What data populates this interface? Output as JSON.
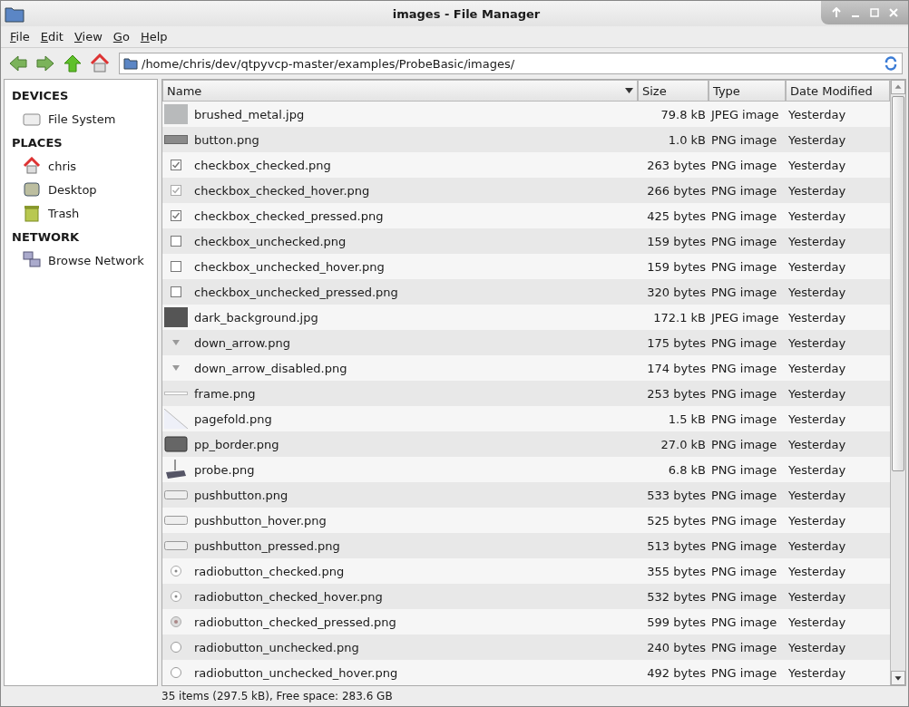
{
  "window": {
    "title": "images - File Manager"
  },
  "menu": [
    "File",
    "Edit",
    "View",
    "Go",
    "Help"
  ],
  "location": "/home/chris/dev/qtpyvcp-master/examples/ProbeBasic/images/",
  "sidebar": [
    {
      "heading": "DEVICES",
      "items": [
        {
          "label": "File System",
          "kind": "drive"
        }
      ]
    },
    {
      "heading": "PLACES",
      "items": [
        {
          "label": "chris",
          "kind": "home"
        },
        {
          "label": "Desktop",
          "kind": "desktop"
        },
        {
          "label": "Trash",
          "kind": "trash"
        }
      ]
    },
    {
      "heading": "NETWORK",
      "items": [
        {
          "label": "Browse Network",
          "kind": "network"
        }
      ]
    }
  ],
  "table": {
    "columns": [
      "Name",
      "Size",
      "Type",
      "Date Modified"
    ],
    "rows": [
      {
        "name": "brushed_metal.jpg",
        "size": "79.8 kB",
        "type": "JPEG image",
        "date": "Yesterday",
        "kind": "texture"
      },
      {
        "name": "button.png",
        "size": "1.0 kB",
        "type": "PNG image",
        "date": "Yesterday",
        "kind": "bar"
      },
      {
        "name": "checkbox_checked.png",
        "size": "263 bytes",
        "type": "PNG image",
        "date": "Yesterday",
        "kind": "checkbox"
      },
      {
        "name": "checkbox_checked_hover.png",
        "size": "266 bytes",
        "type": "PNG image",
        "date": "Yesterday",
        "kind": "checkbox-light"
      },
      {
        "name": "checkbox_checked_pressed.png",
        "size": "425 bytes",
        "type": "PNG image",
        "date": "Yesterday",
        "kind": "checkbox"
      },
      {
        "name": "checkbox_unchecked.png",
        "size": "159 bytes",
        "type": "PNG image",
        "date": "Yesterday",
        "kind": "box"
      },
      {
        "name": "checkbox_unchecked_hover.png",
        "size": "159 bytes",
        "type": "PNG image",
        "date": "Yesterday",
        "kind": "box"
      },
      {
        "name": "checkbox_unchecked_pressed.png",
        "size": "320 bytes",
        "type": "PNG image",
        "date": "Yesterday",
        "kind": "box"
      },
      {
        "name": "dark_background.jpg",
        "size": "172.1 kB",
        "type": "JPEG image",
        "date": "Yesterday",
        "kind": "dark"
      },
      {
        "name": "down_arrow.png",
        "size": "175 bytes",
        "type": "PNG image",
        "date": "Yesterday",
        "kind": "arrow"
      },
      {
        "name": "down_arrow_disabled.png",
        "size": "174 bytes",
        "type": "PNG image",
        "date": "Yesterday",
        "kind": "arrow"
      },
      {
        "name": "frame.png",
        "size": "253 bytes",
        "type": "PNG image",
        "date": "Yesterday",
        "kind": "line"
      },
      {
        "name": "pagefold.png",
        "size": "1.5 kB",
        "type": "PNG image",
        "date": "Yesterday",
        "kind": "fold"
      },
      {
        "name": "pp_border.png",
        "size": "27.0 kB",
        "type": "PNG image",
        "date": "Yesterday",
        "kind": "border"
      },
      {
        "name": "probe.png",
        "size": "6.8 kB",
        "type": "PNG image",
        "date": "Yesterday",
        "kind": "probe"
      },
      {
        "name": "pushbutton.png",
        "size": "533 bytes",
        "type": "PNG image",
        "date": "Yesterday",
        "kind": "pill"
      },
      {
        "name": "pushbutton_hover.png",
        "size": "525 bytes",
        "type": "PNG image",
        "date": "Yesterday",
        "kind": "pill"
      },
      {
        "name": "pushbutton_pressed.png",
        "size": "513 bytes",
        "type": "PNG image",
        "date": "Yesterday",
        "kind": "pill"
      },
      {
        "name": "radiobutton_checked.png",
        "size": "355 bytes",
        "type": "PNG image",
        "date": "Yesterday",
        "kind": "radio"
      },
      {
        "name": "radiobutton_checked_hover.png",
        "size": "532 bytes",
        "type": "PNG image",
        "date": "Yesterday",
        "kind": "radio"
      },
      {
        "name": "radiobutton_checked_pressed.png",
        "size": "599 bytes",
        "type": "PNG image",
        "date": "Yesterday",
        "kind": "radio-pressed"
      },
      {
        "name": "radiobutton_unchecked.png",
        "size": "240 bytes",
        "type": "PNG image",
        "date": "Yesterday",
        "kind": "radio-empty"
      },
      {
        "name": "radiobutton_unchecked_hover.png",
        "size": "492 bytes",
        "type": "PNG image",
        "date": "Yesterday",
        "kind": "radio-empty"
      }
    ]
  },
  "status_bar": "35 items (297.5 kB), Free space: 283.6 GB"
}
